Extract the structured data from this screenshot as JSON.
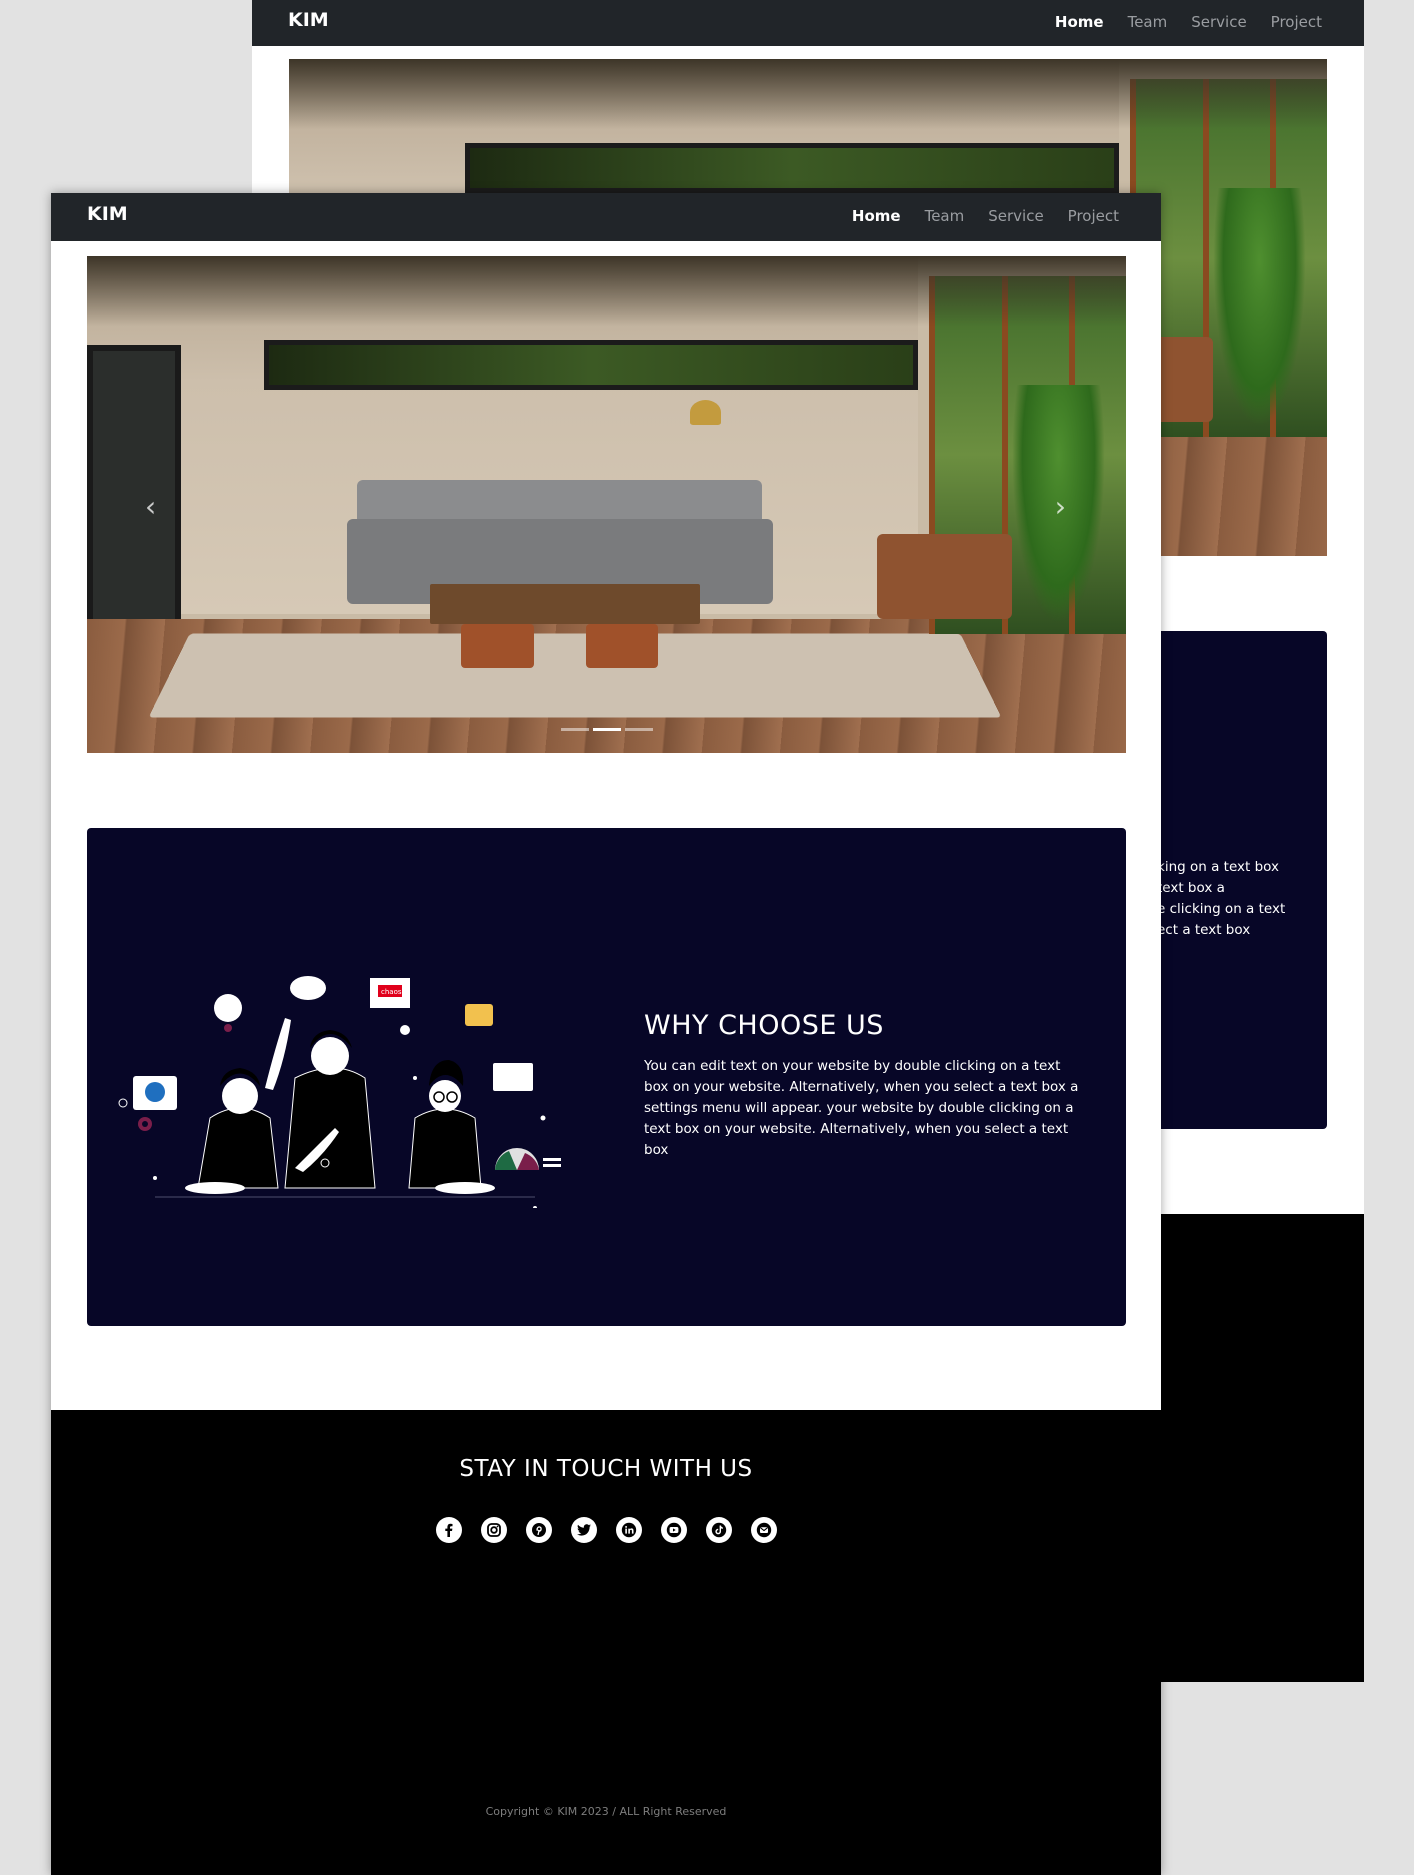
{
  "navbar": {
    "brand": "KIM",
    "links": [
      {
        "label": "Home",
        "active": true
      },
      {
        "label": "Team",
        "active": false
      },
      {
        "label": "Service",
        "active": false
      },
      {
        "label": "Project",
        "active": false
      }
    ]
  },
  "hero": {
    "slide_count": 3,
    "active_slide": 2,
    "prev_icon": "chevron-left-icon",
    "next_icon": "chevron-right-icon"
  },
  "why": {
    "title": "WHY CHOOSE US",
    "body": "You can edit text on your website by double clicking on a text box on your website. Alternatively, when you select a text box a settings menu will appear. your website by double clicking on a text box on your website. Alternatively, when you select a text box",
    "back_lines": [
      "king on a text box",
      "text box a",
      "e clicking on a text",
      "ect a text box"
    ],
    "illustration_sign": "chaos"
  },
  "footer": {
    "title": "STAY IN TOUCH WITH US",
    "social_icons": [
      "facebook-icon",
      "instagram-icon",
      "pinterest-icon",
      "twitter-icon",
      "linkedin-icon",
      "youtube-icon",
      "tiktok-icon",
      "mail-icon"
    ],
    "copyright": "Copyright © KIM 2023 / ALL Right Reserved"
  },
  "colors": {
    "navbar_bg": "#212529",
    "why_bg": "#070627",
    "footer_bg": "#000000",
    "page_bg": "#e2e2e2"
  }
}
